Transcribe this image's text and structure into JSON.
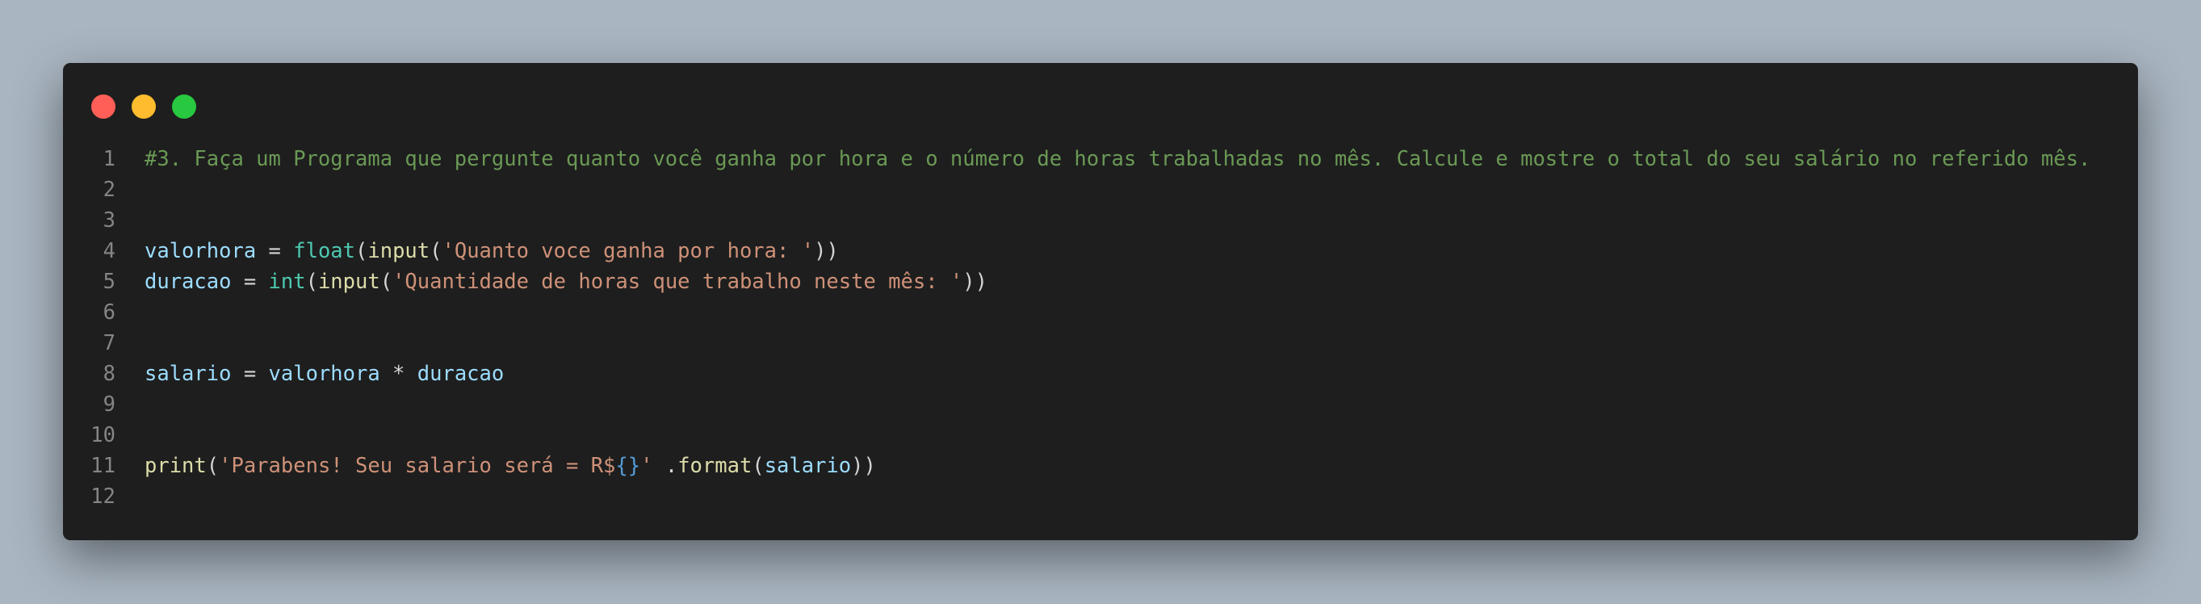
{
  "window": {
    "controls": [
      "close",
      "minimize",
      "maximize"
    ],
    "colors": {
      "close": "#ff5f57",
      "minimize": "#febc2e",
      "maximize": "#28c840",
      "background": "#1e1e1e"
    }
  },
  "code": {
    "language": "python",
    "lines": [
      {
        "number": "1",
        "tokens": [
          {
            "type": "comment",
            "text": "#3. Faça um Programa que pergunte quanto você ganha por hora e o número de horas trabalhadas no mês. Calcule e mostre o total do seu salário no referido mês."
          }
        ]
      },
      {
        "number": "2",
        "tokens": []
      },
      {
        "number": "3",
        "tokens": []
      },
      {
        "number": "4",
        "tokens": [
          {
            "type": "var",
            "text": "valorhora"
          },
          {
            "type": "op",
            "text": " = "
          },
          {
            "type": "builtin",
            "text": "float"
          },
          {
            "type": "op",
            "text": "("
          },
          {
            "type": "func",
            "text": "input"
          },
          {
            "type": "op",
            "text": "("
          },
          {
            "type": "str",
            "text": "'Quanto voce ganha por hora: '"
          },
          {
            "type": "op",
            "text": "))"
          }
        ]
      },
      {
        "number": "5",
        "tokens": [
          {
            "type": "var",
            "text": "duracao"
          },
          {
            "type": "op",
            "text": " = "
          },
          {
            "type": "builtin",
            "text": "int"
          },
          {
            "type": "op",
            "text": "("
          },
          {
            "type": "func",
            "text": "input"
          },
          {
            "type": "op",
            "text": "("
          },
          {
            "type": "str",
            "text": "'Quantidade de horas que trabalho neste mês: '"
          },
          {
            "type": "op",
            "text": "))"
          }
        ]
      },
      {
        "number": "6",
        "tokens": []
      },
      {
        "number": "7",
        "tokens": []
      },
      {
        "number": "8",
        "tokens": [
          {
            "type": "var",
            "text": "salario"
          },
          {
            "type": "op",
            "text": " = "
          },
          {
            "type": "var",
            "text": "valorhora"
          },
          {
            "type": "op",
            "text": " * "
          },
          {
            "type": "var",
            "text": "duracao"
          }
        ]
      },
      {
        "number": "9",
        "tokens": []
      },
      {
        "number": "10",
        "tokens": []
      },
      {
        "number": "11",
        "tokens": [
          {
            "type": "func",
            "text": "print"
          },
          {
            "type": "op",
            "text": "("
          },
          {
            "type": "str",
            "text": "'Parabens! Seu salario será = R$"
          },
          {
            "type": "brace",
            "text": "{}"
          },
          {
            "type": "str",
            "text": "'"
          },
          {
            "type": "op",
            "text": " ."
          },
          {
            "type": "func",
            "text": "format"
          },
          {
            "type": "op",
            "text": "("
          },
          {
            "type": "var",
            "text": "salario"
          },
          {
            "type": "op",
            "text": "))"
          }
        ]
      },
      {
        "number": "12",
        "tokens": []
      }
    ]
  }
}
